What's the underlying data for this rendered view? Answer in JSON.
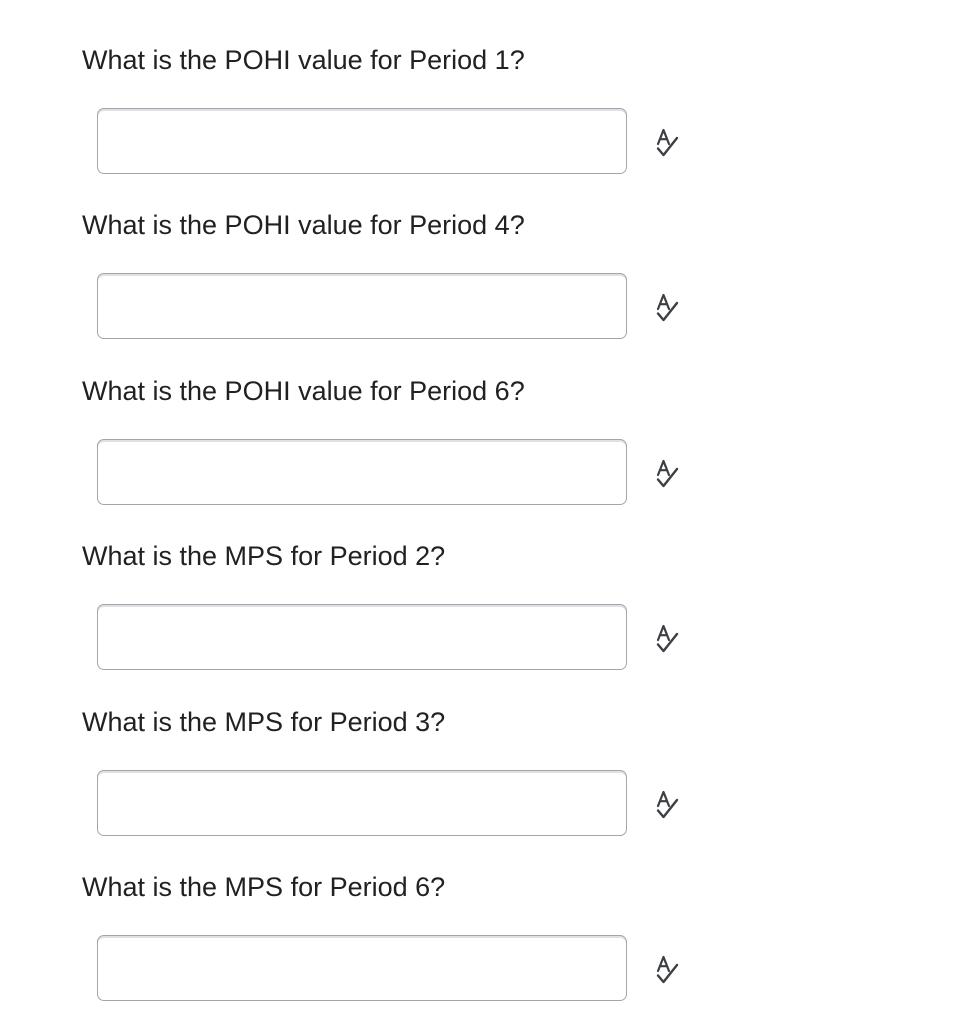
{
  "questions": [
    {
      "label": "What is the POHI value for Period 1?",
      "value": "",
      "icon": "spellcheck-icon"
    },
    {
      "label": "What is the POHI value for Period 4?",
      "value": "",
      "icon": "spellcheck-icon"
    },
    {
      "label": "What is the POHI value for Period 6?",
      "value": "",
      "icon": "spellcheck-icon"
    },
    {
      "label": "What is the MPS for Period 2?",
      "value": "",
      "icon": "spellcheck-icon"
    },
    {
      "label": "What is the MPS for Period 3?",
      "value": "",
      "icon": "spellcheck-icon"
    },
    {
      "label": "What is the MPS for Period 6?",
      "value": "",
      "icon": "spellcheck-icon"
    }
  ],
  "colors": {
    "text": "#202122",
    "input_border": "#a3a6ab",
    "icon": "#3c3f44"
  }
}
